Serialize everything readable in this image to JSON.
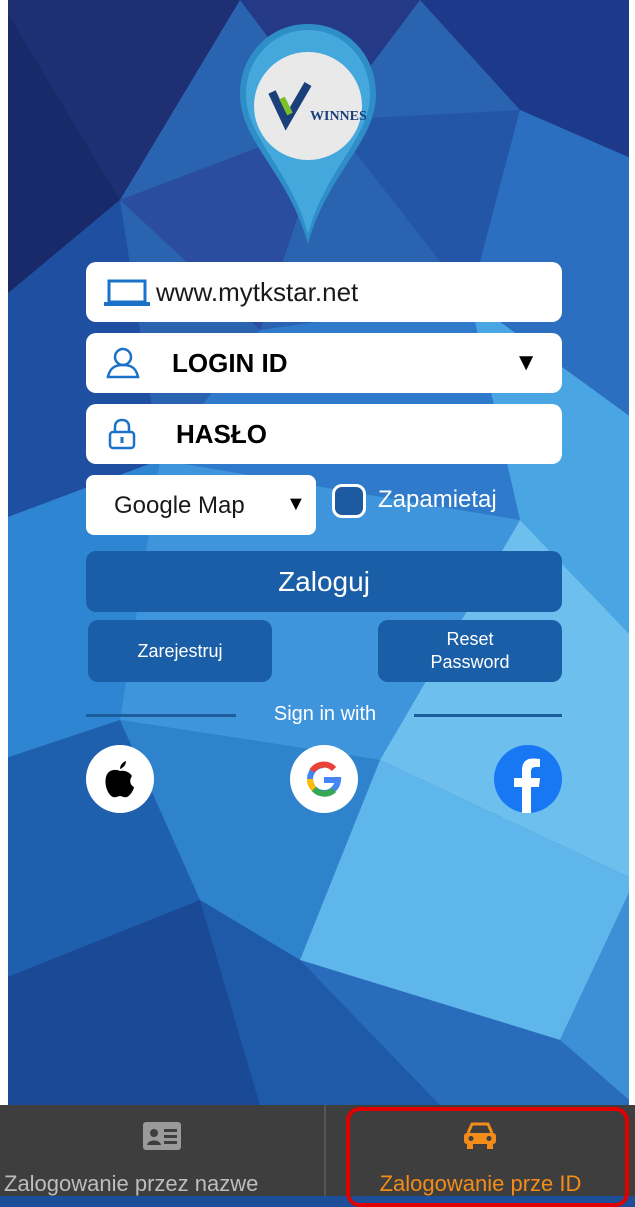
{
  "brand": {
    "logo_text": "WINNES"
  },
  "form": {
    "server_url": "www.mytkstar.net",
    "login_placeholder": "LOGIN ID",
    "password_placeholder": "HASŁO",
    "dropdown_arrow": "▼",
    "map_select": {
      "value": "Google Map",
      "arrow": "▼"
    },
    "remember_label": "Zapamietaj",
    "remember_checked": true
  },
  "buttons": {
    "login": "Zaloguj",
    "register": "Zarejestruj",
    "reset_line1": "Reset",
    "reset_line2": "Password"
  },
  "social": {
    "divider_label": "Sign in with",
    "providers": [
      "apple-icon",
      "google-icon",
      "facebook-icon"
    ]
  },
  "bottom_tabs": [
    {
      "label": "Zalogowanie przez nazwe",
      "icon": "id-card-icon",
      "active": false
    },
    {
      "label": "Zalogowanie prze ID",
      "icon": "car-icon",
      "active": true
    }
  ],
  "colors": {
    "button_blue": "#1a5ea7",
    "active_tab": "#f28c1a",
    "highlight": "#e00000"
  }
}
